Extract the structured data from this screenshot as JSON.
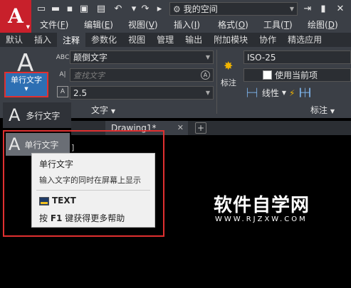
{
  "app": {
    "logo_letter": "A"
  },
  "quick_access": {
    "icons": [
      "new-file-icon",
      "open-folder-icon",
      "save-icon",
      "save-as-icon",
      "print-icon",
      "undo-icon",
      "redo-icon",
      "share-icon"
    ],
    "workspace": "我的空间",
    "right_icons": [
      "signin-icon",
      "close-icon"
    ]
  },
  "menubar": {
    "items": [
      {
        "label": "文件",
        "key": "F"
      },
      {
        "label": "编辑",
        "key": "E"
      },
      {
        "label": "视图",
        "key": "V"
      },
      {
        "label": "插入",
        "key": "I"
      },
      {
        "label": "格式",
        "key": "O"
      },
      {
        "label": "工具",
        "key": "T"
      },
      {
        "label": "绘图",
        "key": "D"
      }
    ]
  },
  "ribbon_tabs": [
    "默认",
    "插入",
    "注释",
    "参数化",
    "视图",
    "管理",
    "输出",
    "附加模块",
    "协作",
    "精选应用"
  ],
  "active_tab": "注释",
  "text_panel": {
    "big_icon_letter": "A",
    "single_line_label": "单行文字",
    "text_style_value": "颠倒文字",
    "find_placeholder": "查找文字",
    "text_height_value": "2.5",
    "panel_label": "文字"
  },
  "annotation_panel": {
    "tool_label": "标注",
    "dimstyle_value": "ISO-25",
    "use_current_label": "使用当前项",
    "linear_label": "线性",
    "panel_label": "标注"
  },
  "text_tools_menu": {
    "multi_line": "多行文字",
    "single_line": "单行文字"
  },
  "doc_tabs": [
    {
      "label": "Drawing1*"
    }
  ],
  "tooltip": {
    "title": "单行文字",
    "description": "输入文字的同时在屏幕上显示",
    "command": "TEXT",
    "help_prefix": "按",
    "help_key": "F1",
    "help_suffix": "键获得更多帮助"
  },
  "watermark": {
    "title": "软件自学网",
    "url": "WWW.RJZXW.COM"
  },
  "colors": {
    "highlight_box": "#e03030",
    "accent_blue": "#2d6fb3",
    "logo_red": "#c8202b"
  }
}
